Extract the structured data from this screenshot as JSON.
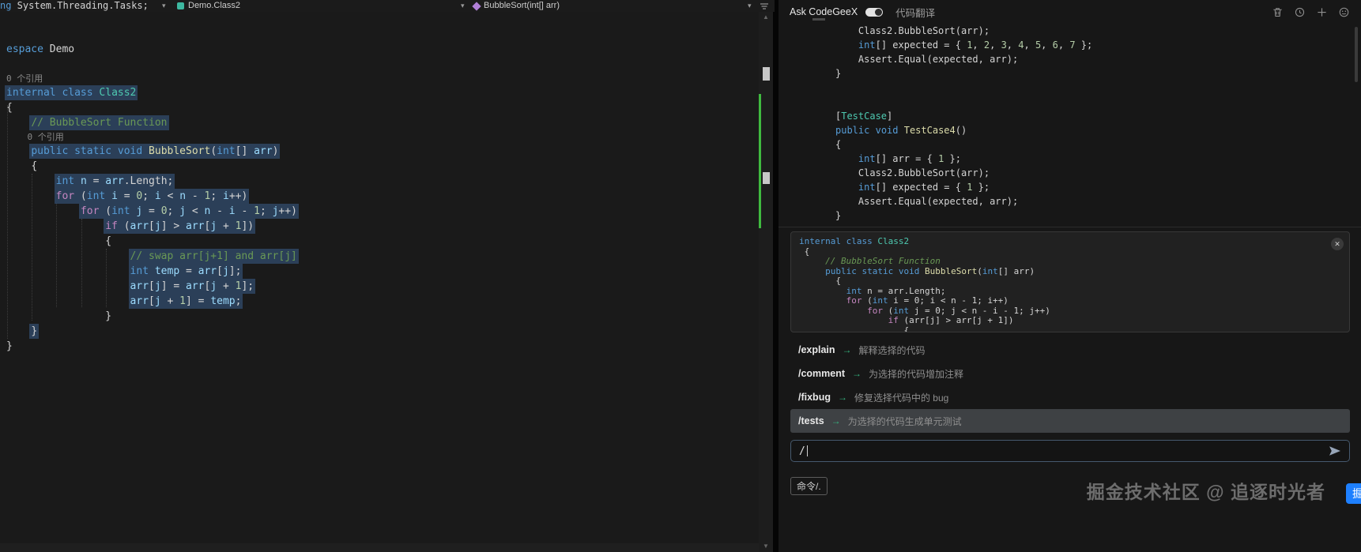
{
  "icons": {
    "chevron_down": "▾",
    "scroll_up": "▲",
    "scroll_down": "▼",
    "close": "✕",
    "arrow_right": "→"
  },
  "navbar": {
    "partial": [
      {
        "ind": 0,
        "tk": [
          [
            "k",
            "ng"
          ],
          [
            "p",
            " System.Threading.Tasks;"
          ]
        ]
      }
    ],
    "crumb_class": "Demo.Class2",
    "crumb_member": "BubbleSort(int[] arr)"
  },
  "editor": {
    "lines": [
      {
        "tk": []
      },
      {
        "tk": []
      },
      {
        "ind": 0,
        "tk": [
          [
            "k",
            "espace"
          ],
          [
            "p",
            " Demo"
          ]
        ]
      },
      {
        "tk": []
      },
      {
        "ind": 0,
        "lens": true,
        "tk": [
          [
            "g",
            "0 个引用"
          ]
        ]
      },
      {
        "ind": 0,
        "sel": true,
        "tk": [
          [
            "k",
            "internal"
          ],
          [
            "p",
            " "
          ],
          [
            "k",
            "class"
          ],
          [
            "p",
            " "
          ],
          [
            "ty",
            "Class2"
          ]
        ]
      },
      {
        "ind": 0,
        "tk": [
          [
            "p",
            "{"
          ]
        ]
      },
      {
        "ind": 4,
        "sel": true,
        "tk": [
          [
            "c",
            "// BubbleSort Function"
          ]
        ]
      },
      {
        "ind": 4,
        "lens": true,
        "tk": [
          [
            "g",
            "0 个引用"
          ]
        ]
      },
      {
        "ind": 4,
        "sel": true,
        "tk": [
          [
            "k",
            "public"
          ],
          [
            "p",
            " "
          ],
          [
            "k",
            "static"
          ],
          [
            "p",
            " "
          ],
          [
            "k",
            "void"
          ],
          [
            "p",
            " "
          ],
          [
            "m",
            "BubbleSort"
          ],
          [
            "p",
            "("
          ],
          [
            "k",
            "int"
          ],
          [
            "p",
            "[] "
          ],
          [
            "v",
            "arr"
          ],
          [
            "p",
            ")"
          ]
        ]
      },
      {
        "ind": 4,
        "tk": [
          [
            "p",
            "{"
          ]
        ]
      },
      {
        "ind": 8,
        "sel": true,
        "tk": [
          [
            "k",
            "int"
          ],
          [
            "p",
            " "
          ],
          [
            "v",
            "n"
          ],
          [
            "p",
            " = "
          ],
          [
            "v",
            "arr"
          ],
          [
            "p",
            ".Length;"
          ]
        ]
      },
      {
        "ind": 8,
        "sel": true,
        "tk": [
          [
            "ctl",
            "for"
          ],
          [
            "p",
            " ("
          ],
          [
            "k",
            "int"
          ],
          [
            "p",
            " "
          ],
          [
            "v",
            "i"
          ],
          [
            "p",
            " = "
          ],
          [
            "num",
            "0"
          ],
          [
            "p",
            "; "
          ],
          [
            "v",
            "i"
          ],
          [
            "p",
            " < "
          ],
          [
            "v",
            "n"
          ],
          [
            "p",
            " - "
          ],
          [
            "num",
            "1"
          ],
          [
            "p",
            "; "
          ],
          [
            "v",
            "i"
          ],
          [
            "p",
            "++)"
          ]
        ]
      },
      {
        "ind": 12,
        "sel": true,
        "tk": [
          [
            "ctl",
            "for"
          ],
          [
            "p",
            " ("
          ],
          [
            "k",
            "int"
          ],
          [
            "p",
            " "
          ],
          [
            "v",
            "j"
          ],
          [
            "p",
            " = "
          ],
          [
            "num",
            "0"
          ],
          [
            "p",
            "; "
          ],
          [
            "v",
            "j"
          ],
          [
            "p",
            " < "
          ],
          [
            "v",
            "n"
          ],
          [
            "p",
            " - "
          ],
          [
            "v",
            "i"
          ],
          [
            "p",
            " - "
          ],
          [
            "num",
            "1"
          ],
          [
            "p",
            "; "
          ],
          [
            "v",
            "j"
          ],
          [
            "p",
            "++)"
          ]
        ]
      },
      {
        "ind": 16,
        "sel": true,
        "tk": [
          [
            "ctl",
            "if"
          ],
          [
            "p",
            " ("
          ],
          [
            "v",
            "arr"
          ],
          [
            "p",
            "["
          ],
          [
            "v",
            "j"
          ],
          [
            "p",
            "] > "
          ],
          [
            "v",
            "arr"
          ],
          [
            "p",
            "["
          ],
          [
            "v",
            "j"
          ],
          [
            "p",
            " + "
          ],
          [
            "num",
            "1"
          ],
          [
            "p",
            "])"
          ]
        ]
      },
      {
        "ind": 16,
        "tk": [
          [
            "p",
            "{"
          ]
        ]
      },
      {
        "ind": 20,
        "sel": true,
        "tk": [
          [
            "c",
            "// swap arr[j+1] and arr[j]"
          ]
        ]
      },
      {
        "ind": 20,
        "sel": true,
        "tk": [
          [
            "k",
            "int"
          ],
          [
            "p",
            " "
          ],
          [
            "v",
            "temp"
          ],
          [
            "p",
            " = "
          ],
          [
            "v",
            "arr"
          ],
          [
            "p",
            "["
          ],
          [
            "v",
            "j"
          ],
          [
            "p",
            "];"
          ]
        ]
      },
      {
        "ind": 20,
        "sel": true,
        "tk": [
          [
            "v",
            "arr"
          ],
          [
            "p",
            "["
          ],
          [
            "v",
            "j"
          ],
          [
            "p",
            "] = "
          ],
          [
            "v",
            "arr"
          ],
          [
            "p",
            "["
          ],
          [
            "v",
            "j"
          ],
          [
            "p",
            " + "
          ],
          [
            "num",
            "1"
          ],
          [
            "p",
            "];"
          ]
        ]
      },
      {
        "ind": 20,
        "sel": true,
        "tk": [
          [
            "v",
            "arr"
          ],
          [
            "p",
            "["
          ],
          [
            "v",
            "j"
          ],
          [
            "p",
            " + "
          ],
          [
            "num",
            "1"
          ],
          [
            "p",
            "] = "
          ],
          [
            "v",
            "temp"
          ],
          [
            "p",
            ";"
          ]
        ]
      },
      {
        "ind": 16,
        "tk": [
          [
            "p",
            "}"
          ]
        ]
      },
      {
        "ind": 4,
        "sel": true,
        "tk": [
          [
            "p",
            "}"
          ]
        ]
      },
      {
        "ind": 0,
        "tk": [
          [
            "p",
            "}"
          ]
        ]
      }
    ]
  },
  "panel": {
    "header": {
      "title": "Ask CodeGeeX",
      "tab": "代码翻译"
    },
    "test_code": [
      {
        "ind": 4,
        "tk": [
          [
            "p",
            "Class2.BubbleSort(arr);"
          ]
        ]
      },
      {
        "ind": 4,
        "tk": [
          [
            "k",
            "int"
          ],
          [
            "p",
            "[] expected = { "
          ],
          [
            "num",
            "1"
          ],
          [
            "p",
            ", "
          ],
          [
            "num",
            "2"
          ],
          [
            "p",
            ", "
          ],
          [
            "num",
            "3"
          ],
          [
            "p",
            ", "
          ],
          [
            "num",
            "4"
          ],
          [
            "p",
            ", "
          ],
          [
            "num",
            "5"
          ],
          [
            "p",
            ", "
          ],
          [
            "num",
            "6"
          ],
          [
            "p",
            ", "
          ],
          [
            "num",
            "7"
          ],
          [
            "p",
            " };"
          ]
        ]
      },
      {
        "ind": 4,
        "tk": [
          [
            "p",
            "Assert.Equal(expected, arr);"
          ]
        ]
      },
      {
        "ind": 0,
        "tk": [
          [
            "p",
            "}"
          ]
        ]
      },
      {
        "tk": []
      },
      {
        "tk": []
      },
      {
        "ind": 0,
        "tk": [
          [
            "p",
            "["
          ],
          [
            "ty",
            "TestCase"
          ],
          [
            "p",
            "]"
          ]
        ]
      },
      {
        "ind": 0,
        "tk": [
          [
            "k",
            "public"
          ],
          [
            "p",
            " "
          ],
          [
            "k",
            "void"
          ],
          [
            "p",
            " "
          ],
          [
            "m",
            "TestCase4"
          ],
          [
            "p",
            "()"
          ]
        ]
      },
      {
        "ind": 0,
        "tk": [
          [
            "p",
            "{"
          ]
        ]
      },
      {
        "ind": 4,
        "tk": [
          [
            "k",
            "int"
          ],
          [
            "p",
            "[] arr = { "
          ],
          [
            "num",
            "1"
          ],
          [
            "p",
            " };"
          ]
        ]
      },
      {
        "ind": 4,
        "tk": [
          [
            "p",
            "Class2.BubbleSort(arr);"
          ]
        ]
      },
      {
        "ind": 4,
        "tk": [
          [
            "k",
            "int"
          ],
          [
            "p",
            "[] expected = { "
          ],
          [
            "num",
            "1"
          ],
          [
            "p",
            " };"
          ]
        ]
      },
      {
        "ind": 4,
        "tk": [
          [
            "p",
            "Assert.Equal(expected, arr);"
          ]
        ]
      },
      {
        "ind": 0,
        "tk": [
          [
            "p",
            "}"
          ]
        ]
      }
    ],
    "preview_code": [
      {
        "ind": 0,
        "tk": [
          [
            "k",
            "internal"
          ],
          [
            "p",
            " "
          ],
          [
            "k",
            "class"
          ],
          [
            "p",
            " "
          ],
          [
            "ty",
            "Class2"
          ]
        ]
      },
      {
        "ind": 1,
        "tk": [
          [
            "p",
            "{"
          ]
        ]
      },
      {
        "ind": 5,
        "tk": [
          [
            "ci",
            "// BubbleSort Function"
          ]
        ]
      },
      {
        "ind": 5,
        "tk": [
          [
            "k",
            "public"
          ],
          [
            "p",
            " "
          ],
          [
            "k",
            "static"
          ],
          [
            "p",
            " "
          ],
          [
            "k",
            "void"
          ],
          [
            "p",
            " "
          ],
          [
            "m",
            "BubbleSort"
          ],
          [
            "p",
            "("
          ],
          [
            "k",
            "int"
          ],
          [
            "p",
            "[] arr)"
          ]
        ]
      },
      {
        "ind": 7,
        "tk": [
          [
            "p",
            "{"
          ]
        ]
      },
      {
        "ind": 9,
        "tk": [
          [
            "k",
            "int"
          ],
          [
            "p",
            " n = arr.Length;"
          ]
        ]
      },
      {
        "ind": 9,
        "tk": [
          [
            "ctl",
            "for"
          ],
          [
            "p",
            " ("
          ],
          [
            "k",
            "int"
          ],
          [
            "p",
            " i = 0; i < n - 1; i++)"
          ]
        ]
      },
      {
        "ind": 13,
        "tk": [
          [
            "ctl",
            "for"
          ],
          [
            "p",
            " ("
          ],
          [
            "k",
            "int"
          ],
          [
            "p",
            " j = 0; j < n - i - 1; j++)"
          ]
        ]
      },
      {
        "ind": 17,
        "tk": [
          [
            "ctl",
            "if"
          ],
          [
            "p",
            " (arr[j] > arr[j + 1])"
          ]
        ]
      },
      {
        "ind": 20,
        "tk": [
          [
            "p",
            "{"
          ]
        ]
      }
    ],
    "commands": [
      {
        "cmd": "/explain",
        "desc": "解释选择的代码",
        "active": false
      },
      {
        "cmd": "/comment",
        "desc": "为选择的代码增加注释",
        "active": false
      },
      {
        "cmd": "/fixbug",
        "desc": "修复选择代码中的 bug",
        "active": false
      },
      {
        "cmd": "/tests",
        "desc": "为选择的代码生成单元测试",
        "active": true
      }
    ],
    "input": {
      "value": "/"
    },
    "footer": {
      "hint": "命令/.",
      "watermark": "掘金技术社区 @ 追逐时光者",
      "badge": "掘金"
    }
  }
}
